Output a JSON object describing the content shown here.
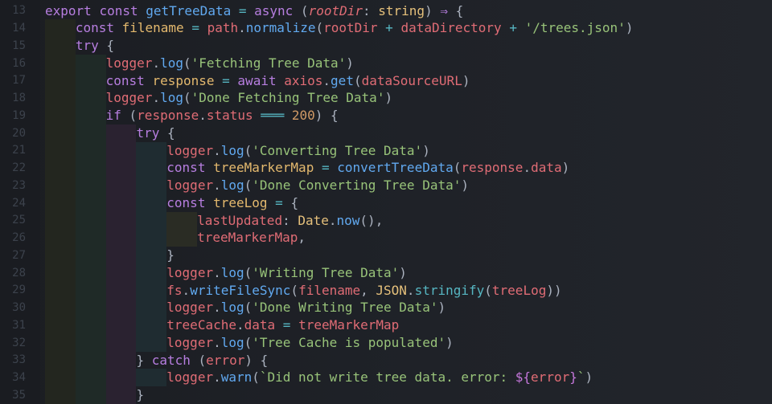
{
  "editor": {
    "language": "typescript",
    "line_numbers": [
      "13",
      "14",
      "15",
      "16",
      "17",
      "18",
      "19",
      "20",
      "21",
      "22",
      "23",
      "24",
      "25",
      "26",
      "27",
      "28",
      "29",
      "30",
      "31",
      "32",
      "33",
      "34",
      "35"
    ],
    "lines": [
      {
        "indent": 0,
        "tokens": [
          [
            "kw",
            "export"
          ],
          [
            "punc",
            " "
          ],
          [
            "kw",
            "const"
          ],
          [
            "punc",
            " "
          ],
          [
            "fn",
            "getTreeData"
          ],
          [
            "op",
            " = "
          ],
          [
            "kw",
            "async"
          ],
          [
            "punc",
            " ("
          ],
          [
            "param",
            "rootDir"
          ],
          [
            "punc",
            ": "
          ],
          [
            "type",
            "string"
          ],
          [
            "punc",
            ") "
          ],
          [
            "kw",
            "⇒"
          ],
          [
            "punc",
            " {"
          ]
        ]
      },
      {
        "indent": 1,
        "tokens": [
          [
            "kw",
            "const"
          ],
          [
            "punc",
            " "
          ],
          [
            "var",
            "filename"
          ],
          [
            "op",
            " = "
          ],
          [
            "red",
            "path"
          ],
          [
            "punc",
            "."
          ],
          [
            "fn",
            "normalize"
          ],
          [
            "punc",
            "("
          ],
          [
            "red",
            "rootDir"
          ],
          [
            "op",
            " + "
          ],
          [
            "red",
            "dataDirectory"
          ],
          [
            "op",
            " + "
          ],
          [
            "str",
            "'/trees.json'"
          ],
          [
            "punc",
            ")"
          ]
        ]
      },
      {
        "indent": 1,
        "tokens": [
          [
            "kw",
            "try"
          ],
          [
            "punc",
            " {"
          ]
        ]
      },
      {
        "indent": 2,
        "tokens": [
          [
            "red",
            "logger"
          ],
          [
            "punc",
            "."
          ],
          [
            "fn",
            "log"
          ],
          [
            "punc",
            "("
          ],
          [
            "str",
            "'Fetching Tree Data'"
          ],
          [
            "punc",
            ")"
          ]
        ]
      },
      {
        "indent": 2,
        "tokens": [
          [
            "kw",
            "const"
          ],
          [
            "punc",
            " "
          ],
          [
            "var",
            "response"
          ],
          [
            "op",
            " = "
          ],
          [
            "kw",
            "await"
          ],
          [
            "punc",
            " "
          ],
          [
            "red",
            "axios"
          ],
          [
            "punc",
            "."
          ],
          [
            "fn",
            "get"
          ],
          [
            "punc",
            "("
          ],
          [
            "red",
            "dataSourceURL"
          ],
          [
            "punc",
            ")"
          ]
        ]
      },
      {
        "indent": 2,
        "tokens": [
          [
            "red",
            "logger"
          ],
          [
            "punc",
            "."
          ],
          [
            "fn",
            "log"
          ],
          [
            "punc",
            "("
          ],
          [
            "str",
            "'Done Fetching Tree Data'"
          ],
          [
            "punc",
            ")"
          ]
        ]
      },
      {
        "indent": 2,
        "tokens": [
          [
            "kw",
            "if"
          ],
          [
            "punc",
            " ("
          ],
          [
            "red",
            "response"
          ],
          [
            "punc",
            "."
          ],
          [
            "red",
            "status"
          ],
          [
            "op",
            " ═══ "
          ],
          [
            "num",
            "200"
          ],
          [
            "punc",
            ") {"
          ]
        ]
      },
      {
        "indent": 3,
        "tokens": [
          [
            "kw",
            "try"
          ],
          [
            "punc",
            " {"
          ]
        ]
      },
      {
        "indent": 4,
        "tokens": [
          [
            "red",
            "logger"
          ],
          [
            "punc",
            "."
          ],
          [
            "fn",
            "log"
          ],
          [
            "punc",
            "("
          ],
          [
            "str",
            "'Converting Tree Data'"
          ],
          [
            "punc",
            ")"
          ]
        ]
      },
      {
        "indent": 4,
        "tokens": [
          [
            "kw",
            "const"
          ],
          [
            "punc",
            " "
          ],
          [
            "var",
            "treeMarkerMap"
          ],
          [
            "op",
            " = "
          ],
          [
            "fn",
            "convertTreeData"
          ],
          [
            "punc",
            "("
          ],
          [
            "red",
            "response"
          ],
          [
            "punc",
            "."
          ],
          [
            "red",
            "data"
          ],
          [
            "punc",
            ")"
          ]
        ]
      },
      {
        "indent": 4,
        "tokens": [
          [
            "red",
            "logger"
          ],
          [
            "punc",
            "."
          ],
          [
            "fn",
            "log"
          ],
          [
            "punc",
            "("
          ],
          [
            "str",
            "'Done Converting Tree Data'"
          ],
          [
            "punc",
            ")"
          ]
        ]
      },
      {
        "indent": 4,
        "tokens": [
          [
            "kw",
            "const"
          ],
          [
            "punc",
            " "
          ],
          [
            "var",
            "treeLog"
          ],
          [
            "op",
            " = "
          ],
          [
            "punc",
            "{"
          ]
        ]
      },
      {
        "indent": 5,
        "tokens": [
          [
            "red",
            "lastUpdated"
          ],
          [
            "punc",
            ": "
          ],
          [
            "type",
            "Date"
          ],
          [
            "punc",
            "."
          ],
          [
            "fn",
            "now"
          ],
          [
            "punc",
            "(),"
          ]
        ]
      },
      {
        "indent": 5,
        "tokens": [
          [
            "red",
            "treeMarkerMap"
          ],
          [
            "punc",
            ","
          ]
        ]
      },
      {
        "indent": 4,
        "tokens": [
          [
            "punc",
            "}"
          ]
        ]
      },
      {
        "indent": 4,
        "tokens": [
          [
            "red",
            "logger"
          ],
          [
            "punc",
            "."
          ],
          [
            "fn",
            "log"
          ],
          [
            "punc",
            "("
          ],
          [
            "str",
            "'Writing Tree Data'"
          ],
          [
            "punc",
            ")"
          ]
        ]
      },
      {
        "indent": 4,
        "tokens": [
          [
            "red",
            "fs"
          ],
          [
            "punc",
            "."
          ],
          [
            "fn",
            "writeFileSync"
          ],
          [
            "punc",
            "("
          ],
          [
            "red",
            "filename"
          ],
          [
            "punc",
            ", "
          ],
          [
            "type",
            "JSON"
          ],
          [
            "punc",
            "."
          ],
          [
            "op",
            "stringify"
          ],
          [
            "punc",
            "("
          ],
          [
            "red",
            "treeLog"
          ],
          [
            "punc",
            "))"
          ]
        ]
      },
      {
        "indent": 4,
        "tokens": [
          [
            "red",
            "logger"
          ],
          [
            "punc",
            "."
          ],
          [
            "fn",
            "log"
          ],
          [
            "punc",
            "("
          ],
          [
            "str",
            "'Done Writing Tree Data'"
          ],
          [
            "punc",
            ")"
          ]
        ]
      },
      {
        "indent": 4,
        "tokens": [
          [
            "red",
            "treeCache"
          ],
          [
            "punc",
            "."
          ],
          [
            "red",
            "data"
          ],
          [
            "op",
            " = "
          ],
          [
            "red",
            "treeMarkerMap"
          ]
        ]
      },
      {
        "indent": 4,
        "tokens": [
          [
            "red",
            "logger"
          ],
          [
            "punc",
            "."
          ],
          [
            "fn",
            "log"
          ],
          [
            "punc",
            "("
          ],
          [
            "str",
            "'Tree Cache is populated'"
          ],
          [
            "punc",
            ")"
          ]
        ]
      },
      {
        "indent": 3,
        "tokens": [
          [
            "punc",
            "} "
          ],
          [
            "kw",
            "catch"
          ],
          [
            "punc",
            " ("
          ],
          [
            "red",
            "error"
          ],
          [
            "punc",
            ") {"
          ]
        ]
      },
      {
        "indent": 4,
        "tokens": [
          [
            "red",
            "logger"
          ],
          [
            "punc",
            "."
          ],
          [
            "fn",
            "warn"
          ],
          [
            "punc",
            "("
          ],
          [
            "str",
            "`Did not write tree data. error: "
          ],
          [
            "tpl",
            "${"
          ],
          [
            "red",
            "error"
          ],
          [
            "tpl",
            "}"
          ],
          [
            "str",
            "`"
          ],
          [
            "punc",
            ")"
          ]
        ]
      },
      {
        "indent": 3,
        "tokens": [
          [
            "punc",
            "}"
          ]
        ]
      }
    ],
    "indent_colors": [
      "#23261f",
      "#1f2a27",
      "#2a2230",
      "#1f2c31",
      "#2a2c24"
    ]
  }
}
